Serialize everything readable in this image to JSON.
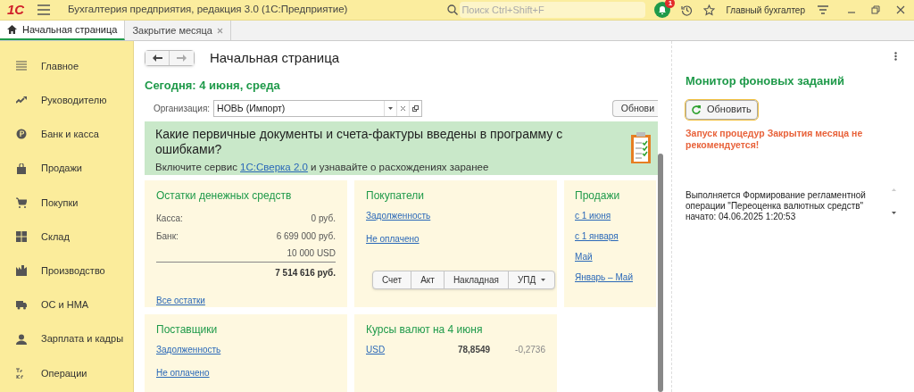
{
  "window": {
    "logo": "1С",
    "title": "Бухгалтерия предприятия, редакция 3.0  (1С:Предприятие)",
    "search_placeholder": "Поиск Ctrl+Shift+F",
    "notification_count": "1",
    "user": "Главный бухгалтер"
  },
  "tabs": [
    {
      "label": "Начальная страница",
      "selected": true,
      "closable": false
    },
    {
      "label": "Закрытие месяца",
      "selected": false,
      "closable": true
    }
  ],
  "sidebar": {
    "items": [
      {
        "label": "Главное"
      },
      {
        "label": "Руководителю"
      },
      {
        "label": "Банк и касса"
      },
      {
        "label": "Продажи"
      },
      {
        "label": "Покупки"
      },
      {
        "label": "Склад"
      },
      {
        "label": "Производство"
      },
      {
        "label": "ОС и НМА"
      },
      {
        "label": "Зарплата и кадры"
      },
      {
        "label": "Операции"
      }
    ]
  },
  "page": {
    "title": "Начальная страница",
    "date_heading": "Сегодня: 4 июня, среда",
    "organization_label": "Организация:",
    "organization_value": "НОВЬ (Импорт)",
    "refresh_button": "Обнови",
    "banner": {
      "title": "Какие первичные документы и счета-фактуры введены в программу с ошибками?",
      "text_before": "Включите сервис",
      "link": "1С:Сверка 2.0",
      "text_after": "и узнавайте о расхождениях заранее"
    },
    "cash": {
      "title": "Остатки денежных средств",
      "rows": [
        {
          "label": "Касса:",
          "value": "0 руб."
        },
        {
          "label": "Банк:",
          "value": "6 699 000 руб."
        },
        {
          "label": "",
          "value": "10 000 USD"
        }
      ],
      "total": "7 514 616 руб.",
      "link": "Все остатки"
    },
    "customers": {
      "title": "Покупатели",
      "links": [
        "Задолженность",
        "Не оплачено"
      ],
      "buttons": [
        "Счет",
        "Акт",
        "Накладная",
        "УПД"
      ]
    },
    "sales": {
      "title": "Продажи",
      "links": [
        "с 1 июня",
        "с 1 января",
        "Май",
        "Январь – Май"
      ]
    },
    "suppliers": {
      "title": "Поставщики",
      "links": [
        "Задолженность",
        "Не оплачено"
      ]
    },
    "rates": {
      "title": "Курсы валют на 4 июня",
      "rows": [
        {
          "currency": "USD",
          "rate": "78,8549",
          "change": "-0,2736"
        }
      ]
    }
  },
  "monitor": {
    "title": "Монитор фоновых заданий",
    "refresh_button": "Обновить",
    "warning": "Запуск процедур Закрытия месяца не рекомендуется!",
    "job": "Выполняется Формирование регламентной операции \"Переоценка валютных средств\" начато: 04.06.2025 1:20:53"
  }
}
